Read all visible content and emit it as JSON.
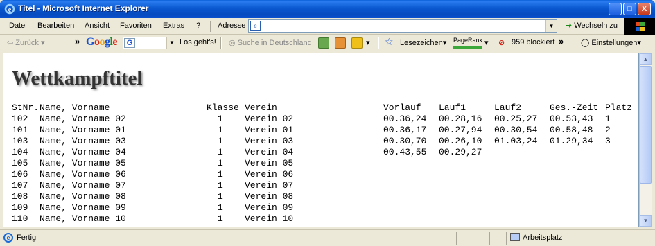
{
  "window": {
    "title": "Titel - Microsoft Internet Explorer",
    "minimize": "_",
    "maximize": "□",
    "close": "X"
  },
  "menu": {
    "items": [
      "Datei",
      "Bearbeiten",
      "Ansicht",
      "Favoriten",
      "Extras",
      "?"
    ]
  },
  "address": {
    "label": "Adresse",
    "value": "",
    "go_label": "Wechseln zu"
  },
  "toolbar": {
    "back": "Zurück",
    "google_search_value": "",
    "go_search": "Los geht's!",
    "search_de": "Suche in Deutschland",
    "bookmarks": "Lesezeichen",
    "pagerank": "PageRank",
    "blocked": "959 blockiert",
    "settings": "Einstellungen"
  },
  "page": {
    "title": "Wettkampftitel",
    "columns": [
      "StNr.",
      "Name, Vorname",
      "Klasse",
      "Verein",
      "Vorlauf",
      "Lauf1",
      "Lauf2",
      "Ges.-Zeit",
      "Platz"
    ],
    "rows": [
      [
        "102",
        "Name, Vorname 02",
        "1",
        "Verein 02",
        "00.36,24",
        "00.28,16",
        "00.25,27",
        "00.53,43",
        "1"
      ],
      [
        "101",
        "Name, Vorname 01",
        "1",
        "Verein 01",
        "00.36,17",
        "00.27,94",
        "00.30,54",
        "00.58,48",
        "2"
      ],
      [
        "103",
        "Name, Vorname 03",
        "1",
        "Verein 03",
        "00.30,70",
        "00.26,10",
        "01.03,24",
        "01.29,34",
        "3"
      ],
      [
        "104",
        "Name, Vorname 04",
        "1",
        "Verein 04",
        "00.43,55",
        "00.29,27",
        "",
        "",
        ""
      ],
      [
        "105",
        "Name, Vorname 05",
        "1",
        "Verein 05",
        "",
        "",
        "",
        "",
        ""
      ],
      [
        "106",
        "Name, Vorname 06",
        "1",
        "Verein 06",
        "",
        "",
        "",
        "",
        ""
      ],
      [
        "107",
        "Name, Vorname 07",
        "1",
        "Verein 07",
        "",
        "",
        "",
        "",
        ""
      ],
      [
        "108",
        "Name, Vorname 08",
        "1",
        "Verein 08",
        "",
        "",
        "",
        "",
        ""
      ],
      [
        "109",
        "Name, Vorname 09",
        "1",
        "Verein 09",
        "",
        "",
        "",
        "",
        ""
      ],
      [
        "110",
        "Name, Vorname 10",
        "1",
        "Verein 10",
        "",
        "",
        "",
        "",
        ""
      ]
    ]
  },
  "status": {
    "text": "Fertig",
    "zone": "Arbeitsplatz"
  },
  "colors": {
    "titlebar": "#0a58d0",
    "title_text": "#333333"
  }
}
